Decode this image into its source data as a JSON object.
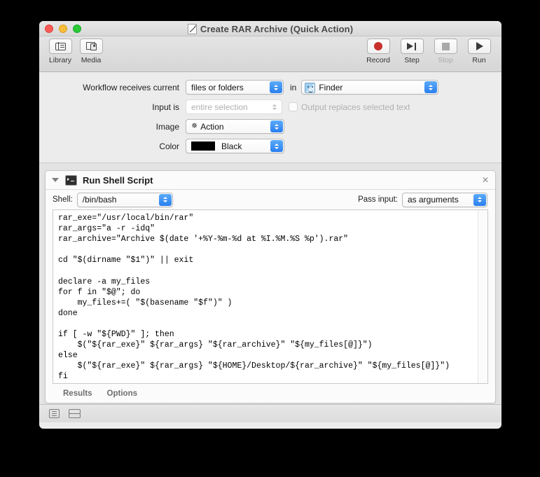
{
  "window": {
    "title": "Create RAR Archive (Quick Action)",
    "doc_icon": "document-icon"
  },
  "traffic_lights": [
    {
      "name": "close-button",
      "color": "#fc5b57"
    },
    {
      "name": "minimize-button",
      "color": "#f6bd3a"
    },
    {
      "name": "zoom-button",
      "color": "#2cc937"
    }
  ],
  "toolbar": {
    "left": [
      {
        "label": "Library",
        "icon": "library-icon",
        "enabled": true
      },
      {
        "label": "Media",
        "icon": "media-icon",
        "enabled": true
      }
    ],
    "right": [
      {
        "label": "Record",
        "icon": "record-icon",
        "enabled": true
      },
      {
        "label": "Step",
        "icon": "step-icon",
        "enabled": true
      },
      {
        "label": "Stop",
        "icon": "stop-icon",
        "enabled": false
      },
      {
        "label": "Run",
        "icon": "run-icon",
        "enabled": true
      }
    ]
  },
  "settings": {
    "receives": {
      "label": "Workflow receives current",
      "value": "files or folders",
      "in_label": "in",
      "app_value": "Finder",
      "app_icon": "finder-icon"
    },
    "input_is": {
      "label": "Input is",
      "value": "entire selection",
      "enabled": false,
      "checkbox_label": "Output replaces selected text",
      "checkbox_checked": false,
      "checkbox_enabled": false
    },
    "image": {
      "label": "Image",
      "value": "Action",
      "icon": "gear-icon"
    },
    "color": {
      "label": "Color",
      "value": "Black",
      "swatch": "#000000"
    }
  },
  "action": {
    "title": "Run Shell Script",
    "icon": "terminal-icon",
    "disclosure": "disclosure-triangle-open",
    "close": "✕",
    "shell": {
      "label": "Shell:",
      "value": "/bin/bash"
    },
    "pass_input": {
      "label": "Pass input:",
      "value": "as arguments"
    },
    "script": "rar_exe=\"/usr/local/bin/rar\"\nrar_args=\"a -r -idq\"\nrar_archive=\"Archive $(date '+%Y-%m-%d at %I.%M.%S %p').rar\"\n\ncd \"$(dirname \"$1\")\" || exit\n\ndeclare -a my_files\nfor f in \"$@\"; do\n    my_files+=( \"$(basename \"$f\")\" )\ndone\n\nif [ -w \"${PWD}\" ]; then\n    $(\"${rar_exe}\" ${rar_args} \"${rar_archive}\" \"${my_files[@]}\")\nelse\n    $(\"${rar_exe}\" ${rar_args} \"${HOME}/Desktop/${rar_archive}\" \"${my_files[@]}\")\nfi",
    "tabs": [
      {
        "label": "Results"
      },
      {
        "label": "Options"
      }
    ]
  },
  "statusbar": {
    "icons": [
      {
        "name": "log-view-icon"
      },
      {
        "name": "split-view-icon"
      }
    ]
  }
}
